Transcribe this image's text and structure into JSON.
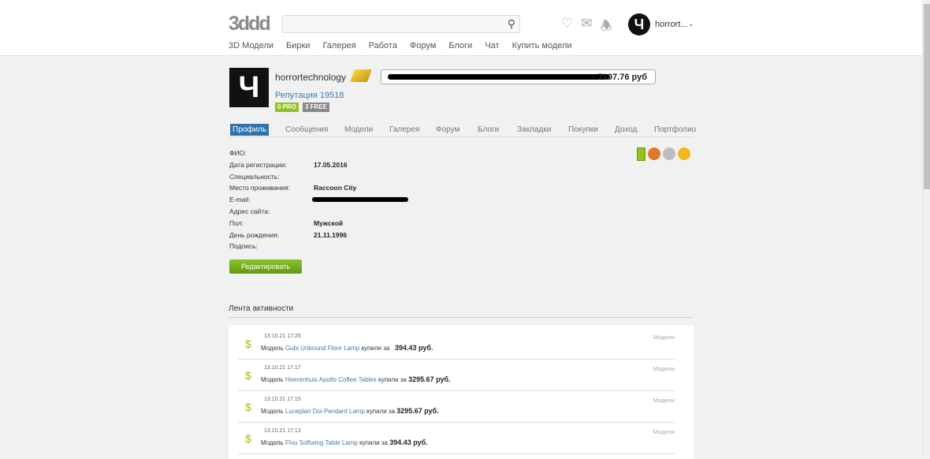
{
  "header": {
    "logo": "3ddd",
    "search_placeholder": "",
    "username": "horrort...",
    "avatar_letter": "Ч",
    "nav": [
      "3D Модели",
      "Бирки",
      "Галерея",
      "Работа",
      "Форум",
      "Блоги",
      "Чат",
      "Купить модели"
    ]
  },
  "profile": {
    "name": "horrortechnology",
    "avatar_letter": "Ч",
    "balance": "7197.76 руб",
    "reputation": "Репутация 19518",
    "pro_badge": "0 PRO",
    "free_badge": "3 FREE",
    "colors": {
      "pro": "#8fc31f",
      "free": "#888888",
      "tab_active": "#2f72a9"
    }
  },
  "tabs": [
    "Профиль",
    "Сообщения",
    "Модели",
    "Галерея",
    "Форум",
    "Блоги",
    "Закладки",
    "Покупки",
    "Доход",
    "Портфолио"
  ],
  "fields": [
    {
      "k": "ФИО:",
      "v": ""
    },
    {
      "k": "Дата регистрации:",
      "v": "17.05.2016"
    },
    {
      "k": "Специальность:",
      "v": ""
    },
    {
      "k": "Место проживания:",
      "v": "Raccoon City"
    },
    {
      "k": "E-mail:",
      "v": ""
    },
    {
      "k": "Адрес сайта:",
      "v": ""
    },
    {
      "k": "Пол:",
      "v": "Мужской"
    },
    {
      "k": "День рождения:",
      "v": "21.11.1996"
    },
    {
      "k": "Подпись:",
      "v": ""
    }
  ],
  "edit_label": "Редактировать",
  "feed": {
    "title": "Лента активности",
    "items": [
      {
        "time": "13.10.21 17:26",
        "prefix": "Модель",
        "model": "Gubi Unbound Floor Lamp",
        "mid": "купили за",
        "price": "394.43 руб.",
        "cat": "Модели"
      },
      {
        "time": "13.10.21 17:17",
        "prefix": "Модель",
        "model": "Heerenhuis Apollo Coffee Tables",
        "mid": "купили за",
        "price": "3295.67 руб.",
        "cat": "Модели"
      },
      {
        "time": "13.10.21 17:15",
        "prefix": "Модель",
        "model": "Luceplan Doi Pendant Lamp",
        "mid": "купили за",
        "price": "3295.67 руб.",
        "cat": "Модели"
      },
      {
        "time": "13.10.21 17:13",
        "prefix": "Модель",
        "model": "Flou Softwing Table Lamp",
        "mid": "купили за",
        "price": "394.43 руб.",
        "cat": "Модели"
      }
    ]
  }
}
